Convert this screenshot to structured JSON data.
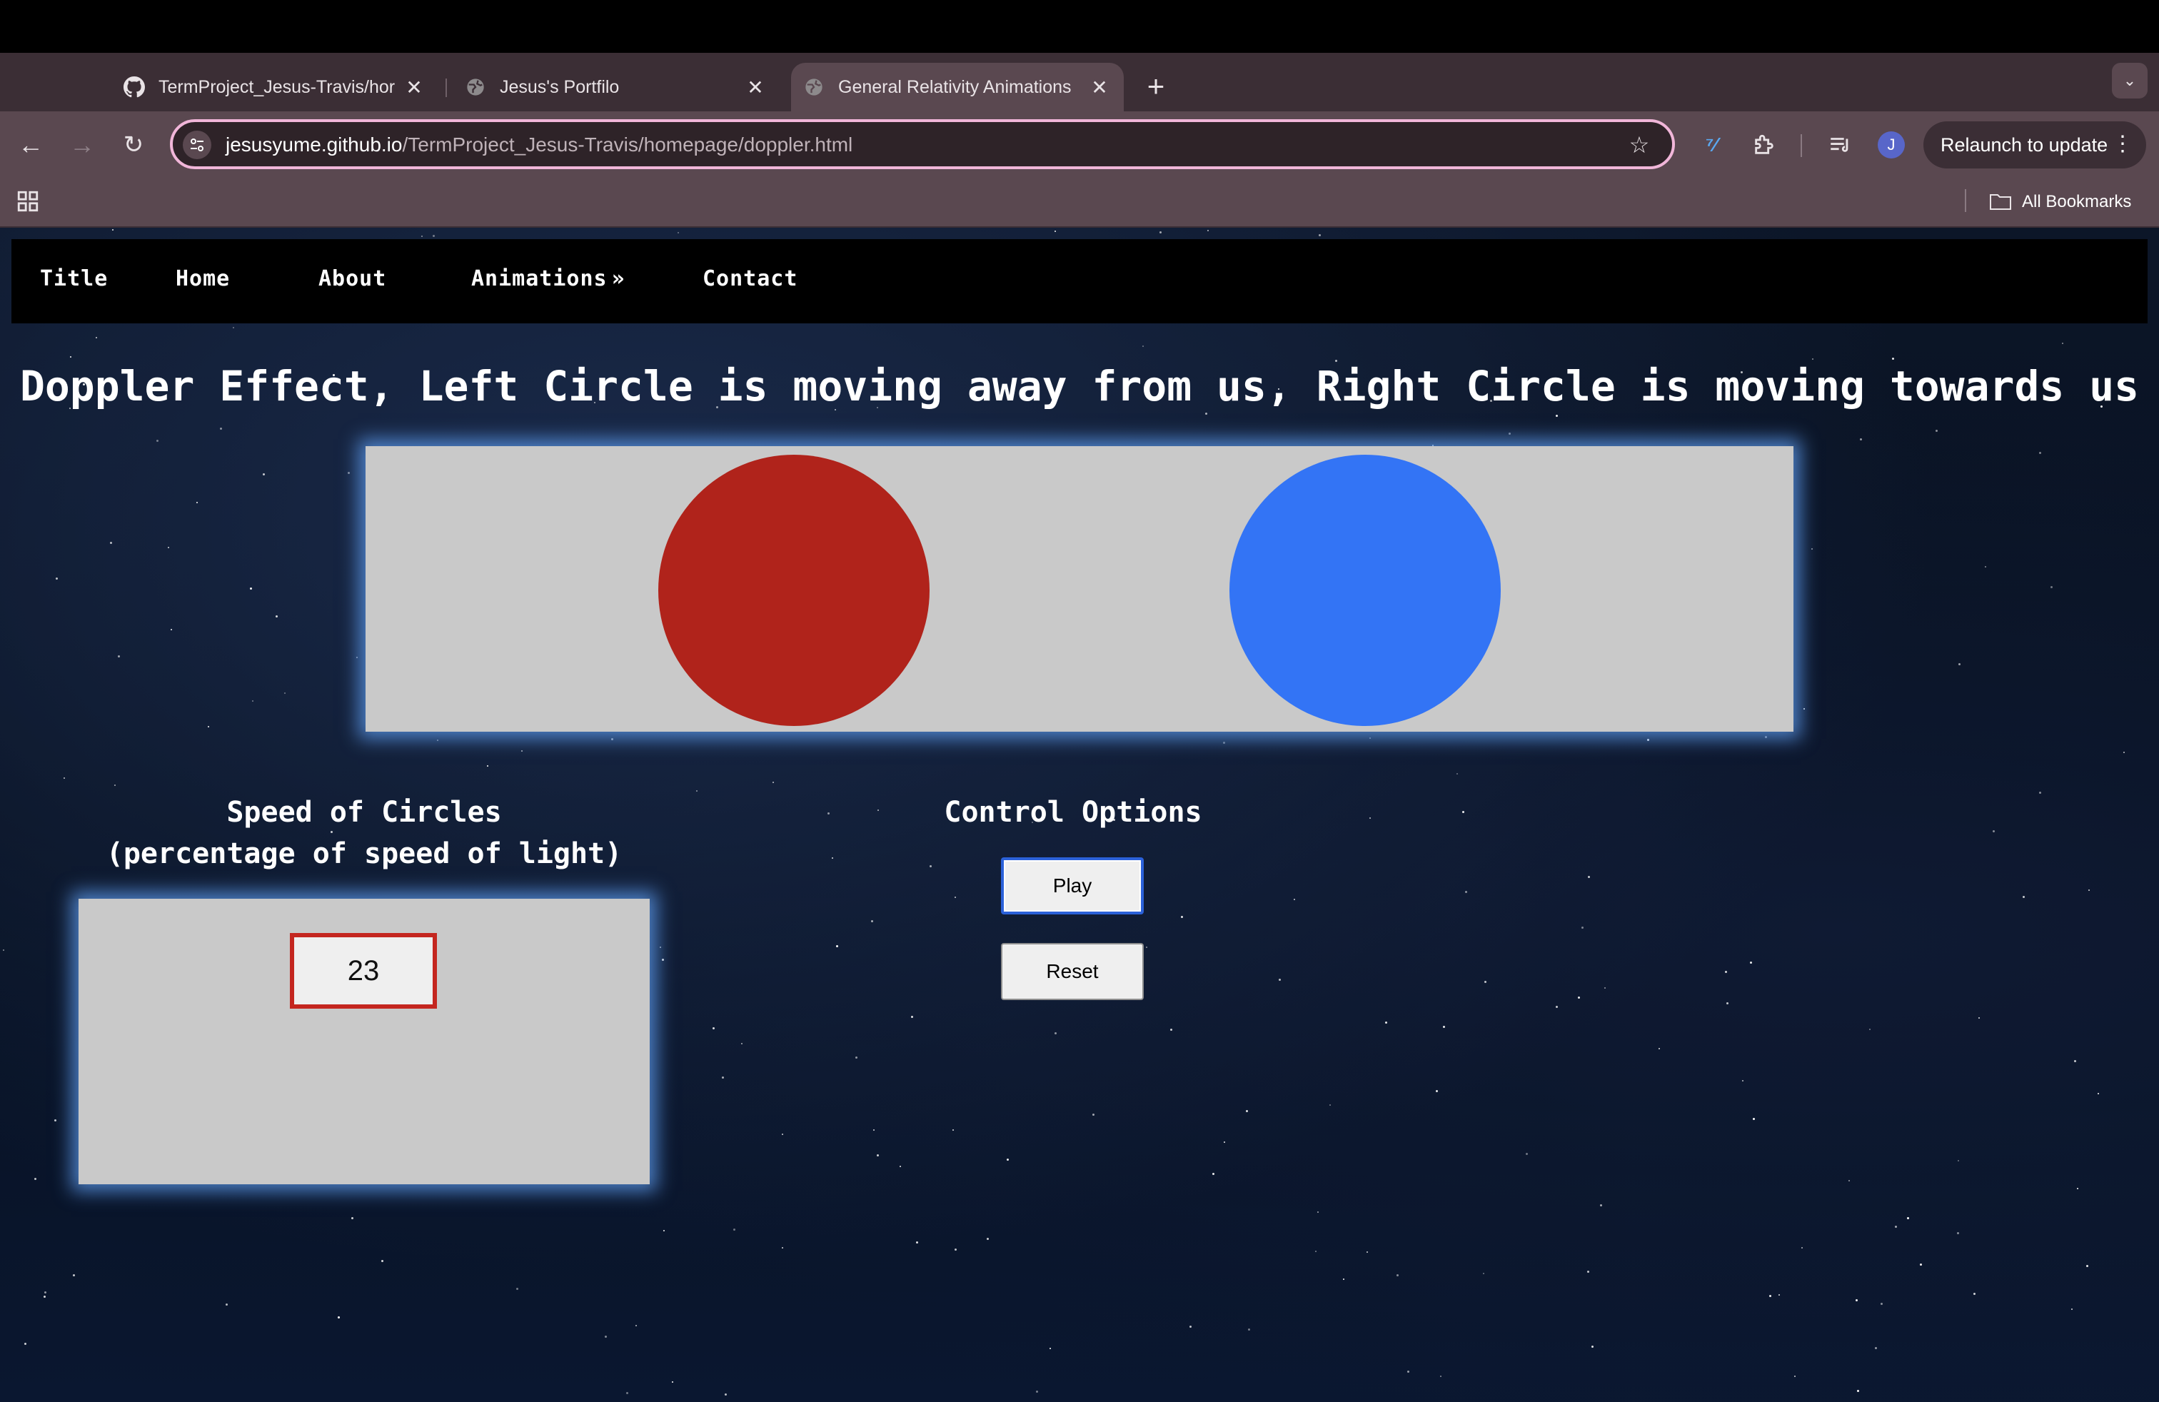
{
  "browser": {
    "tabs": [
      {
        "title": "TermProject_Jesus-Travis/hor",
        "favicon": "github-icon",
        "active": false
      },
      {
        "title": "Jesus's Portfilo",
        "favicon": "globe-icon",
        "active": false
      },
      {
        "title": "General Relativity Animations",
        "favicon": "globe-icon",
        "active": true
      }
    ],
    "url_host": "jesusyume.github.io",
    "url_path": "/TermProject_Jesus-Travis/homepage/doppler.html",
    "avatar_letter": "J",
    "relaunch_label": "Relaunch to update",
    "all_bookmarks_label": "All Bookmarks"
  },
  "nav": {
    "items": [
      "Title",
      "Home",
      "About",
      "Animations",
      "Contact"
    ],
    "animations_chevron": "»"
  },
  "page": {
    "headline": "Doppler Effect, Left Circle is moving away from us, Right Circle is moving towards us",
    "speed_title_line1": "Speed of Circles",
    "speed_title_line2": "(percentage of speed of light)",
    "speed_value": "23",
    "control_title": "Control Options",
    "play_label": "Play",
    "reset_label": "Reset"
  },
  "colors": {
    "left_circle": "#b0231b",
    "right_circle": "#3374f5",
    "omnibox_border": "#f1b6d9",
    "input_border": "#c4261f"
  }
}
